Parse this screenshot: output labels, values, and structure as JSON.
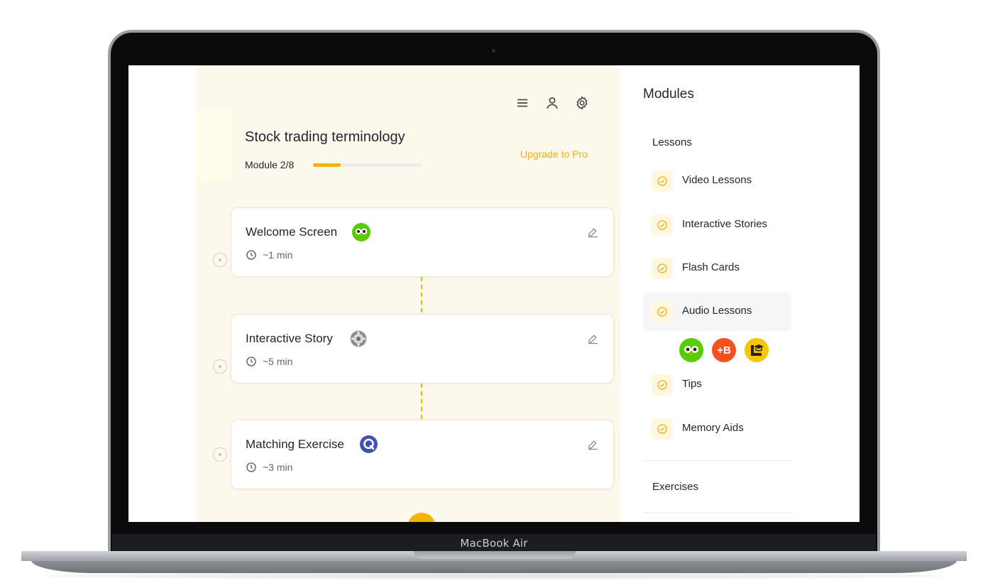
{
  "device": {
    "label": "MacBook Air"
  },
  "header": {
    "icons": [
      "menu-icon",
      "user-icon",
      "settings-icon"
    ],
    "title": "Stock trading terminology",
    "module_label": "Module 2/8",
    "progress": 0.25,
    "upgrade_label": "Upgrade to Pro"
  },
  "cards": [
    {
      "title": "Welcome Screen",
      "time": "~1 min",
      "badge": "owl-badge-icon"
    },
    {
      "title": "Interactive Story",
      "time": "~5 min",
      "badge": "mosaic-badge-icon"
    },
    {
      "title": "Matching Exercise",
      "time": "~3 min",
      "badge": "q-badge-icon"
    }
  ],
  "sidebar": {
    "title": "Modules",
    "lessons_heading": "Lessons",
    "items": [
      {
        "label": "Video Lessons"
      },
      {
        "label": "Interactive Stories"
      },
      {
        "label": "Flash Cards"
      },
      {
        "label": "Audio Lessons"
      },
      {
        "label": "Tips"
      },
      {
        "label": "Memory Aids"
      }
    ],
    "audio_badges": [
      {
        "icon": "owl-badge-icon"
      },
      {
        "icon": "plus-b-badge-icon",
        "text": "+B"
      },
      {
        "icon": "graduation-badge-icon"
      }
    ],
    "exercises_heading": "Exercises"
  },
  "colors": {
    "accent": "#f2b400",
    "panel_bg": "#fdf8ec",
    "text": "#1f2430"
  }
}
